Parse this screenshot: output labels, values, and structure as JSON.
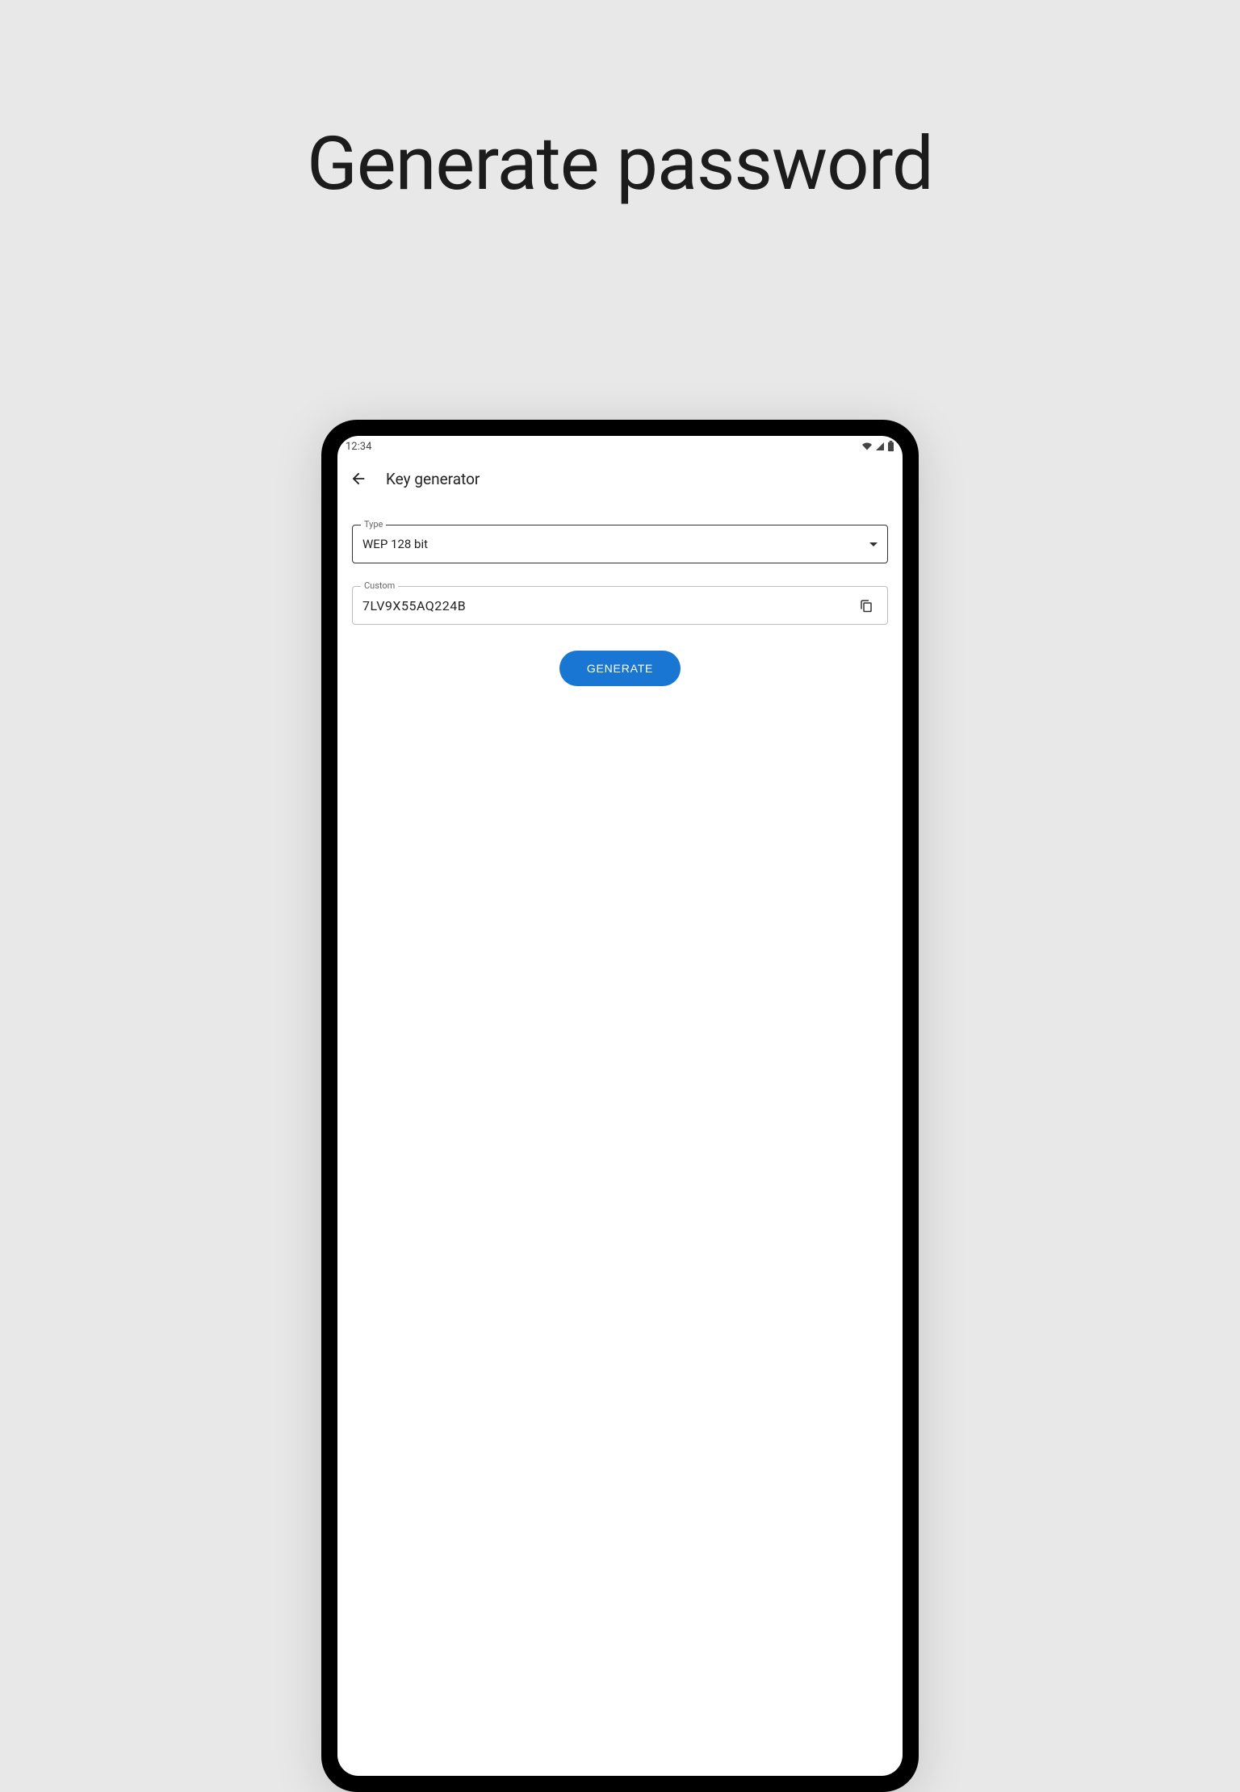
{
  "page": {
    "title": "Generate password"
  },
  "statusbar": {
    "time": "12:34"
  },
  "appbar": {
    "title": "Key generator"
  },
  "form": {
    "type_label": "Type",
    "type_value": "WEP 128 bit",
    "custom_label": "Custom",
    "custom_value": "7LV9X55AQ224B",
    "generate_label": "GENERATE"
  },
  "colors": {
    "accent": "#1976d2"
  }
}
